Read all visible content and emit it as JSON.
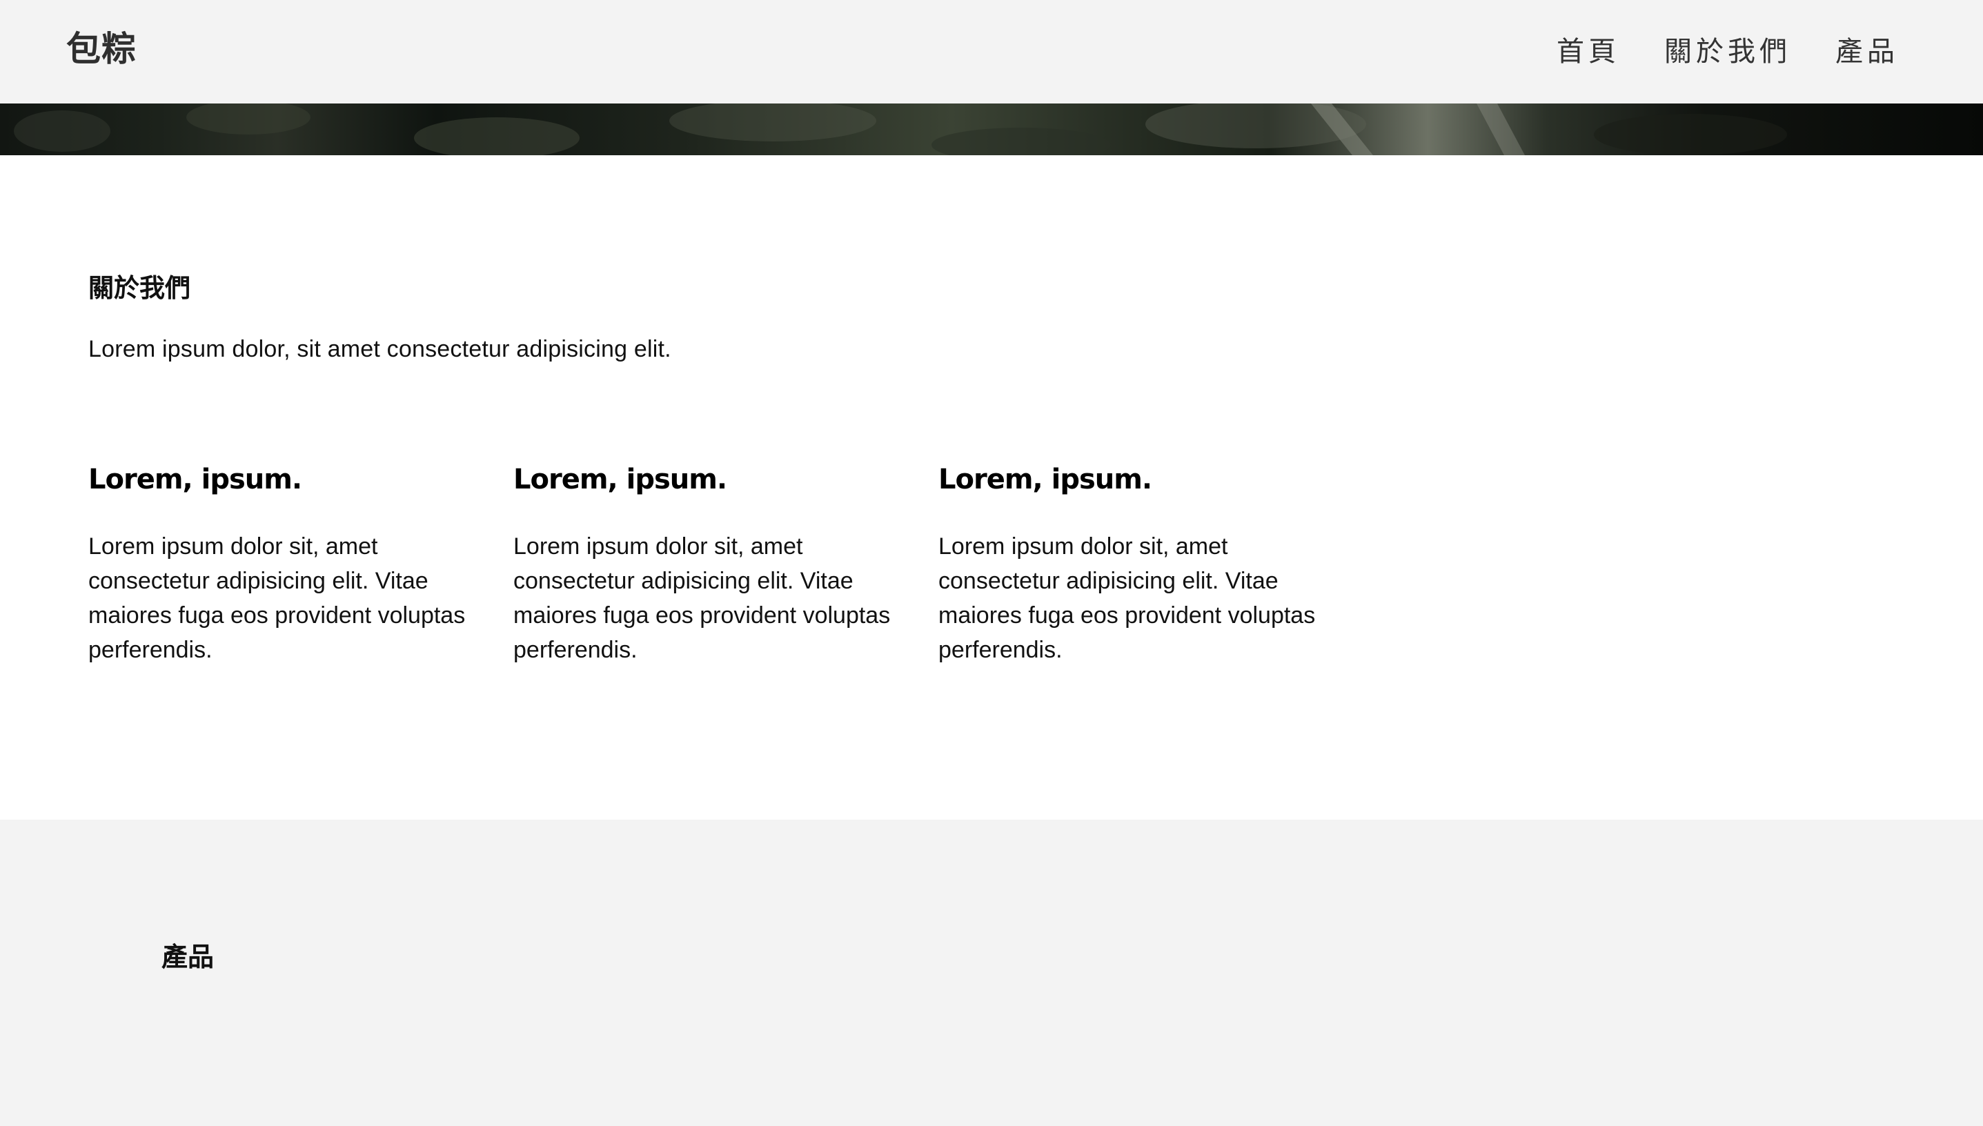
{
  "header": {
    "logo": "包粽",
    "nav": [
      {
        "label": "首頁"
      },
      {
        "label": "關於我們"
      },
      {
        "label": "產品"
      }
    ]
  },
  "about": {
    "title": "關於我們",
    "description": "Lorem ipsum dolor, sit amet consectetur adipisicing elit.",
    "features": [
      {
        "title": "Lorem, ipsum.",
        "body": "Lorem ipsum dolor sit, amet consectetur adipisicing elit. Vitae maiores fuga eos provident voluptas perferendis."
      },
      {
        "title": "Lorem, ipsum.",
        "body": "Lorem ipsum dolor sit, amet consectetur adipisicing elit. Vitae maiores fuga eos provident voluptas perferendis."
      },
      {
        "title": "Lorem, ipsum.",
        "body": "Lorem ipsum dolor sit, amet consectetur adipisicing elit. Vitae maiores fuga eos provident voluptas perferendis."
      }
    ]
  },
  "products": {
    "title": "產品"
  },
  "colors": {
    "header_bg": "#f3f3f3",
    "section_bg": "#ffffff",
    "products_bg": "#f3f3f3",
    "text": "#111111"
  }
}
